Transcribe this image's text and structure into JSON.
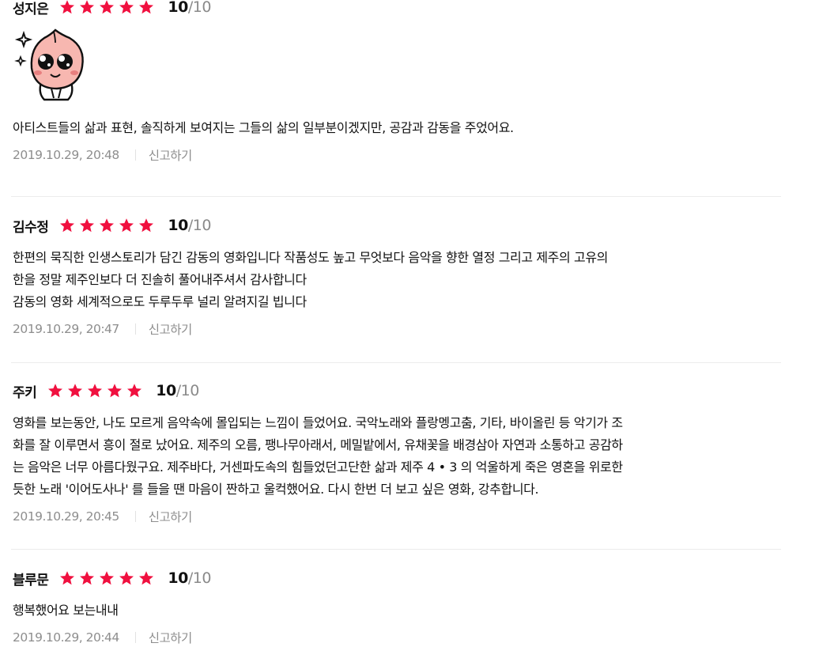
{
  "rating_icon": "star-icon",
  "star_color": "#f0103f",
  "reviews": [
    {
      "author": "성지은",
      "stars": 5,
      "score": "10",
      "max": "/10",
      "emoticon": "peach-crying-emoticon",
      "text": "아티스트들의 삶과 표현, 솔직하게 보여지는 그들의 삶의 일부분이겠지만, 공감과 감동을 주었어요.",
      "date": "2019.10.29, 20:48",
      "report": "신고하기"
    },
    {
      "author": "김수정",
      "stars": 5,
      "score": "10",
      "max": "/10",
      "text": "한편의 묵직한 인생스토리가 담긴 감동의 영화입니다 작품성도 높고 무엇보다 음악을 향한 열정 그리고 제주의 고유의\n한을 정말 제주인보다 더 진솔히 풀어내주셔서 감사합니다\n감동의 영화 세계적으로도 두루두루 널리 알려지길 빕니다",
      "date": "2019.10.29, 20:47",
      "report": "신고하기"
    },
    {
      "author": "주키",
      "stars": 5,
      "score": "10",
      "max": "/10",
      "text": "영화를 보는동안, 나도 모르게 음악속에 몰입되는 느낌이 들었어요. 국악노래와 플랑멩고춤, 기타, 바이올린 등 악기가 조\n화를 잘 이루면서 흥이 절로 났어요. 제주의 오름, 팽나무아래서, 메밀밭에서, 유채꽃을 배경삼아 자연과 소통하고 공감하\n는 음악은 너무 아름다웠구요. 제주바다, 거센파도속의 힘들었던고단한 삶과 제주 4 • 3 의 억울하게 죽은 영혼을 위로한\n듯한 노래 '이어도사나' 를 들을 땐 마음이 짠하고 울컥했어요. 다시 한번 더 보고 싶은 영화, 강추합니다.",
      "date": "2019.10.29, 20:45",
      "report": "신고하기"
    },
    {
      "author": "블루문",
      "stars": 5,
      "score": "10",
      "max": "/10",
      "text": "행복했어요 보는내내",
      "date": "2019.10.29, 20:44",
      "report": "신고하기"
    }
  ]
}
